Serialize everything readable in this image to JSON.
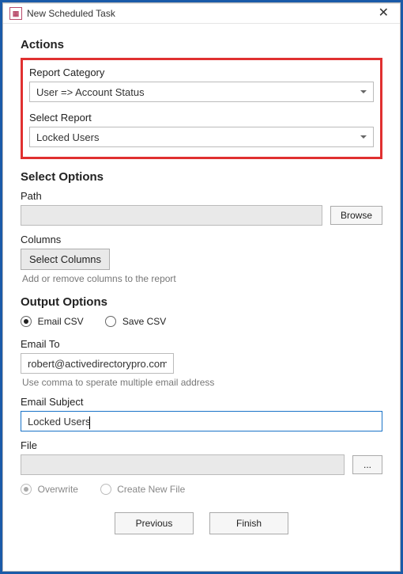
{
  "window": {
    "title": "New Scheduled Task"
  },
  "actions": {
    "heading": "Actions",
    "reportCategoryLabel": "Report Category",
    "reportCategoryValue": "User => Account Status",
    "selectReportLabel": "Select Report",
    "selectReportValue": "Locked Users"
  },
  "selectOptions": {
    "heading": "Select Options",
    "pathLabel": "Path",
    "pathValue": "",
    "browseLabel": "Browse",
    "columnsLabel": "Columns",
    "selectColumnsLabel": "Select Columns",
    "columnsHint": "Add or remove columns to the report"
  },
  "outputOptions": {
    "heading": "Output Options",
    "emailCsvLabel": "Email CSV",
    "saveCsvLabel": "Save CSV",
    "emailToLabel": "Email To",
    "emailToValue": "robert@activedirectorypro.com",
    "emailToHint": "Use comma to sperate multiple email address",
    "emailSubjectLabel": "Email Subject",
    "emailSubjectValue": "Locked Users",
    "fileLabel": "File",
    "fileValue": "",
    "fileBrowseLabel": "...",
    "overwriteLabel": "Overwrite",
    "createNewLabel": "Create New File"
  },
  "nav": {
    "previous": "Previous",
    "finish": "Finish"
  }
}
